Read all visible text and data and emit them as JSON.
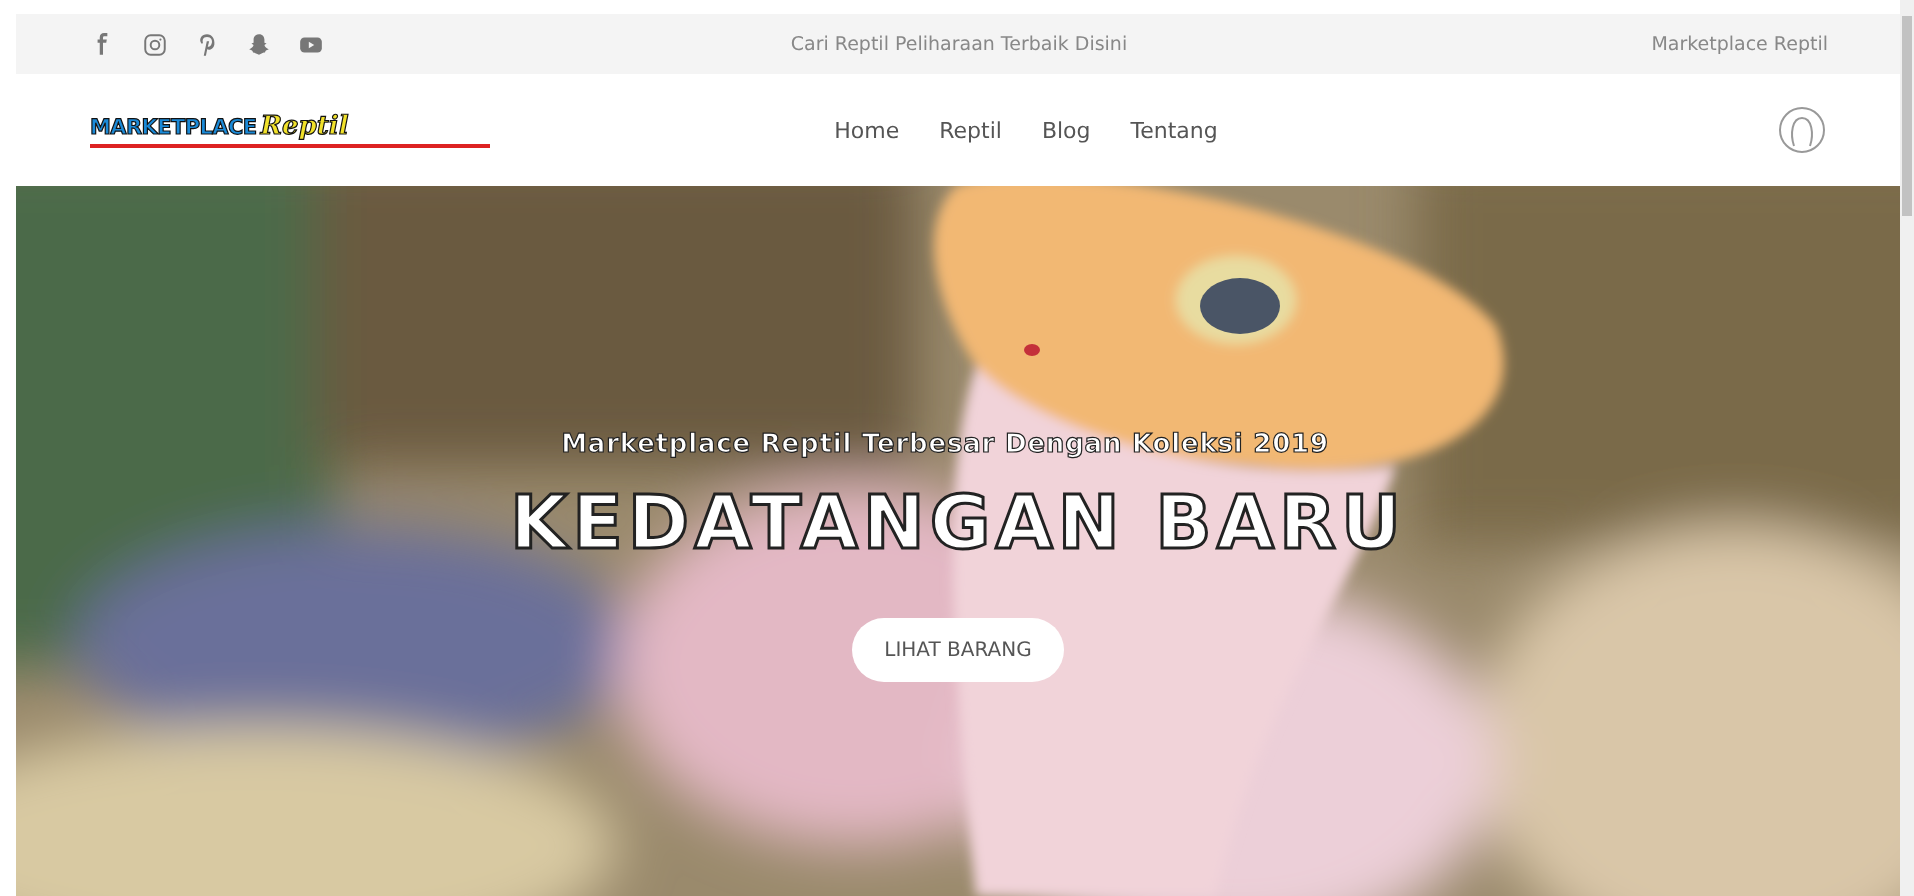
{
  "topbar": {
    "social": [
      {
        "kind": "facebook"
      },
      {
        "kind": "instagram"
      },
      {
        "kind": "pinterest"
      },
      {
        "kind": "snapchat"
      },
      {
        "kind": "youtube"
      }
    ],
    "tagline": "Cari Reptil Peliharaan Terbaik Disini",
    "brand": "Marketplace Reptil"
  },
  "header": {
    "logo": {
      "main": "MARKETPLACE",
      "accent": "Reptil"
    },
    "nav": [
      {
        "label": "Home"
      },
      {
        "label": "Reptil"
      },
      {
        "label": "Blog"
      },
      {
        "label": "Tentang"
      }
    ]
  },
  "hero": {
    "subtitle": "Marketplace Reptil Terbesar Dengan Koleksi 2019",
    "title": "KEDATANGAN BARU",
    "button": "LIHAT BARANG"
  }
}
